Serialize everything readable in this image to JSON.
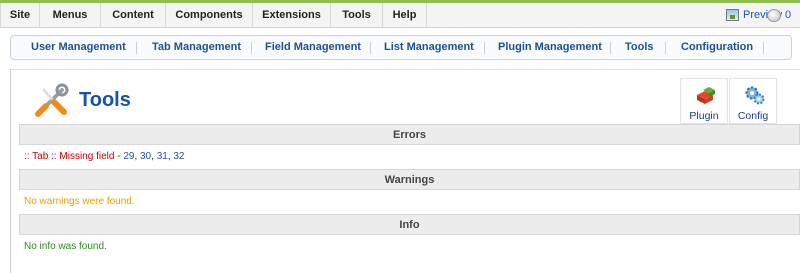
{
  "topmenu": {
    "items": [
      "Site",
      "Menus",
      "Content",
      "Components",
      "Extensions",
      "Tools",
      "Help"
    ],
    "preview_label": "Preview",
    "messages_count": "0"
  },
  "submenu": {
    "items": [
      "User Management",
      "Tab Management",
      "Field Management",
      "List Management",
      "Plugin Management",
      "Tools",
      "Configuration"
    ]
  },
  "page": {
    "title": "Tools"
  },
  "toolbar": {
    "plugin_label": "Plugin",
    "config_label": "Config"
  },
  "sections": {
    "errors": {
      "heading": "Errors",
      "message": ":: Tab :: Missing field",
      "separator": " - ",
      "ids": [
        "29",
        "30",
        "31",
        "32"
      ]
    },
    "warnings": {
      "heading": "Warnings",
      "message": "No warnings were found."
    },
    "info": {
      "heading": "Info",
      "message": "No info was found."
    }
  },
  "colors": {
    "accent_green": "#8fbe4e",
    "link_blue": "#1f55b3",
    "title_blue": "#1554a8",
    "error_red": "#cc0000",
    "warning_orange": "#e8a000",
    "info_green": "#2d8a1e"
  }
}
